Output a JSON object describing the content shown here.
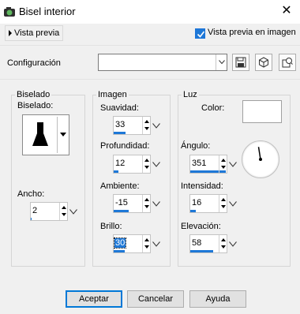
{
  "window": {
    "title": "Bisel interior",
    "close_icon": "close-icon",
    "app_icon": "app-icon"
  },
  "preview": {
    "toggle_label": "Vista previa",
    "checkbox_label": "Vista previa en imagen",
    "checkbox_checked": true
  },
  "config": {
    "label": "Configuración",
    "value": ""
  },
  "bevel": {
    "group_label": "Biselado",
    "shape_label": "Biselado:",
    "width_label": "Ancho:",
    "width": {
      "value": "2",
      "level": 0.03
    }
  },
  "image": {
    "group_label": "Imagen",
    "smoothness": {
      "label": "Suavidad:",
      "value": "33",
      "level": 0.33
    },
    "depth": {
      "label": "Profundidad:",
      "value": "12",
      "level": 0.12
    },
    "ambience": {
      "label": "Ambiente:",
      "value": "-15",
      "level": 0.42
    },
    "brightness": {
      "label": "Brillo:",
      "value": "30",
      "level": 0.3
    }
  },
  "light": {
    "group_label": "Luz",
    "color_label": "Color:",
    "color": "#ffffff",
    "angle": {
      "label": "Ángulo:",
      "value": "351",
      "level": 0.98
    },
    "intensity": {
      "label": "Intensidad:",
      "value": "16",
      "level": 0.16
    },
    "elevation": {
      "label": "Elevación:",
      "value": "58",
      "level": 0.64
    }
  },
  "buttons": {
    "accept": "Aceptar",
    "cancel": "Cancelar",
    "help": "Ayuda"
  },
  "colors": {
    "accent": "#1e78d7"
  }
}
